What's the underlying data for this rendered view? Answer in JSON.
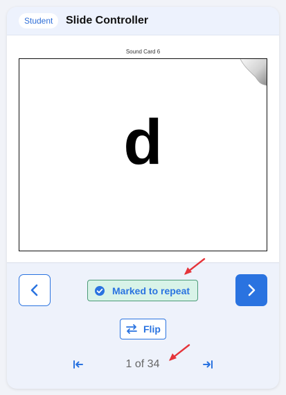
{
  "header": {
    "role_badge": "Student",
    "title": "Slide Controller"
  },
  "card": {
    "caption": "Sound Card 6",
    "letter": "d"
  },
  "controls": {
    "prev_icon": "chevron-left-icon",
    "next_icon": "chevron-right-icon",
    "repeat_label": "Marked to repeat",
    "repeat_icon": "check-circle-icon",
    "flip_label": "Flip",
    "flip_icon": "swap-arrows-icon"
  },
  "pager": {
    "text": "1 of 34",
    "first_icon": "first-page-icon",
    "last_icon": "last-page-icon"
  },
  "colors": {
    "accent": "#2a73e0",
    "repeat_bg": "#d8f3e8",
    "repeat_border": "#4c9b78",
    "annotation": "#e5343a"
  }
}
